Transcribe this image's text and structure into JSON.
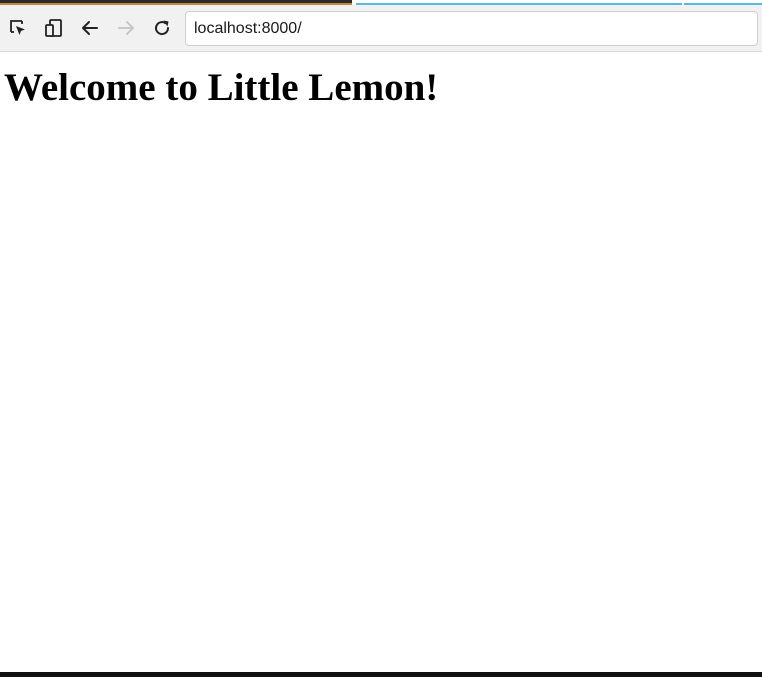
{
  "browser": {
    "address": "localhost:8000/",
    "icons": {
      "inspect": "inspect-element-icon",
      "device": "device-toggle-icon",
      "back": "back-arrow-icon",
      "forward": "forward-arrow-icon",
      "reload": "reload-icon"
    },
    "colors": {
      "toolbar_bg": "#f1f1f1",
      "tab_accent": "#5ab7e0",
      "forward_disabled": "#c8c8c8"
    }
  },
  "page": {
    "heading": "Welcome to Little Lemon!"
  }
}
